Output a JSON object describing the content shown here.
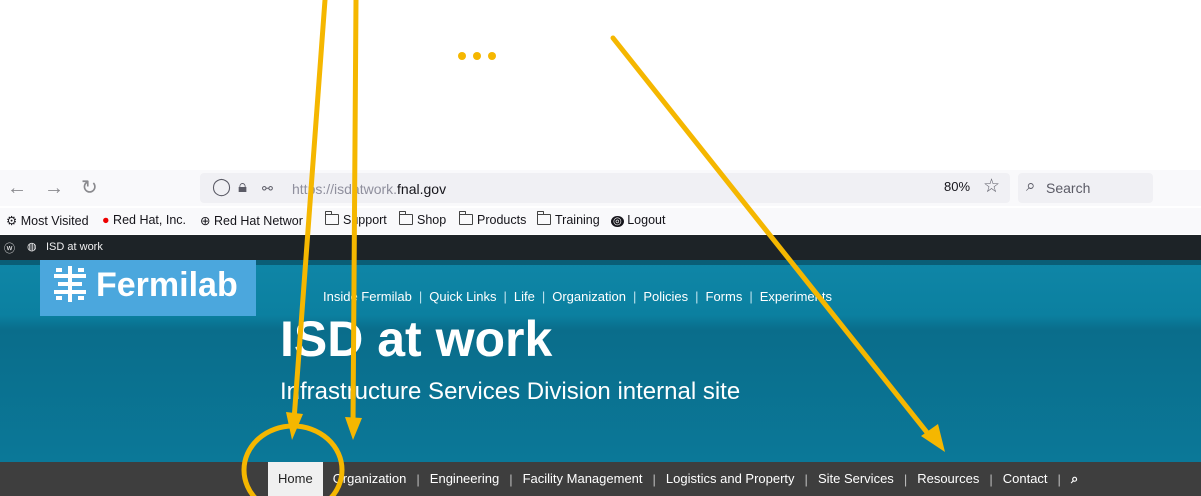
{
  "browser": {
    "url_prefix": "https://isdatwork.",
    "url_domain": "fnal.gov",
    "zoom": "80%",
    "search_placeholder": "Search"
  },
  "bookmarks": [
    {
      "label": "Most Visited",
      "icon": "gear-icon"
    },
    {
      "label": "Red Hat, Inc.",
      "icon": "red-hat-icon"
    },
    {
      "label": "Red Hat Networ",
      "icon": "globe-icon"
    },
    {
      "label": "Support",
      "icon": "folder-icon"
    },
    {
      "label": "Shop",
      "icon": "folder-icon"
    },
    {
      "label": "Products",
      "icon": "folder-icon"
    },
    {
      "label": "Training",
      "icon": "folder-icon"
    },
    {
      "label": "Logout",
      "icon": "logout-icon"
    }
  ],
  "admin_bar": {
    "site_name": "ISD at work"
  },
  "site": {
    "logo_text": "Fermilab",
    "title": "ISD at work",
    "subtitle": "Infrastructure Services Division internal site",
    "top_nav": [
      "Inside Fermilab",
      "Quick Links",
      "Life",
      "Organization",
      "Policies",
      "Forms",
      "Experiments"
    ],
    "main_menu": [
      "Home",
      "Organization",
      "Engineering",
      "Facility Management",
      "Logistics and Property",
      "Site Services",
      "Resources",
      "Contact"
    ],
    "active_menu": "Home"
  },
  "colors": {
    "annotation": "#f5b700",
    "header": "#0b7898",
    "menu_bar": "#3e3e3e"
  }
}
